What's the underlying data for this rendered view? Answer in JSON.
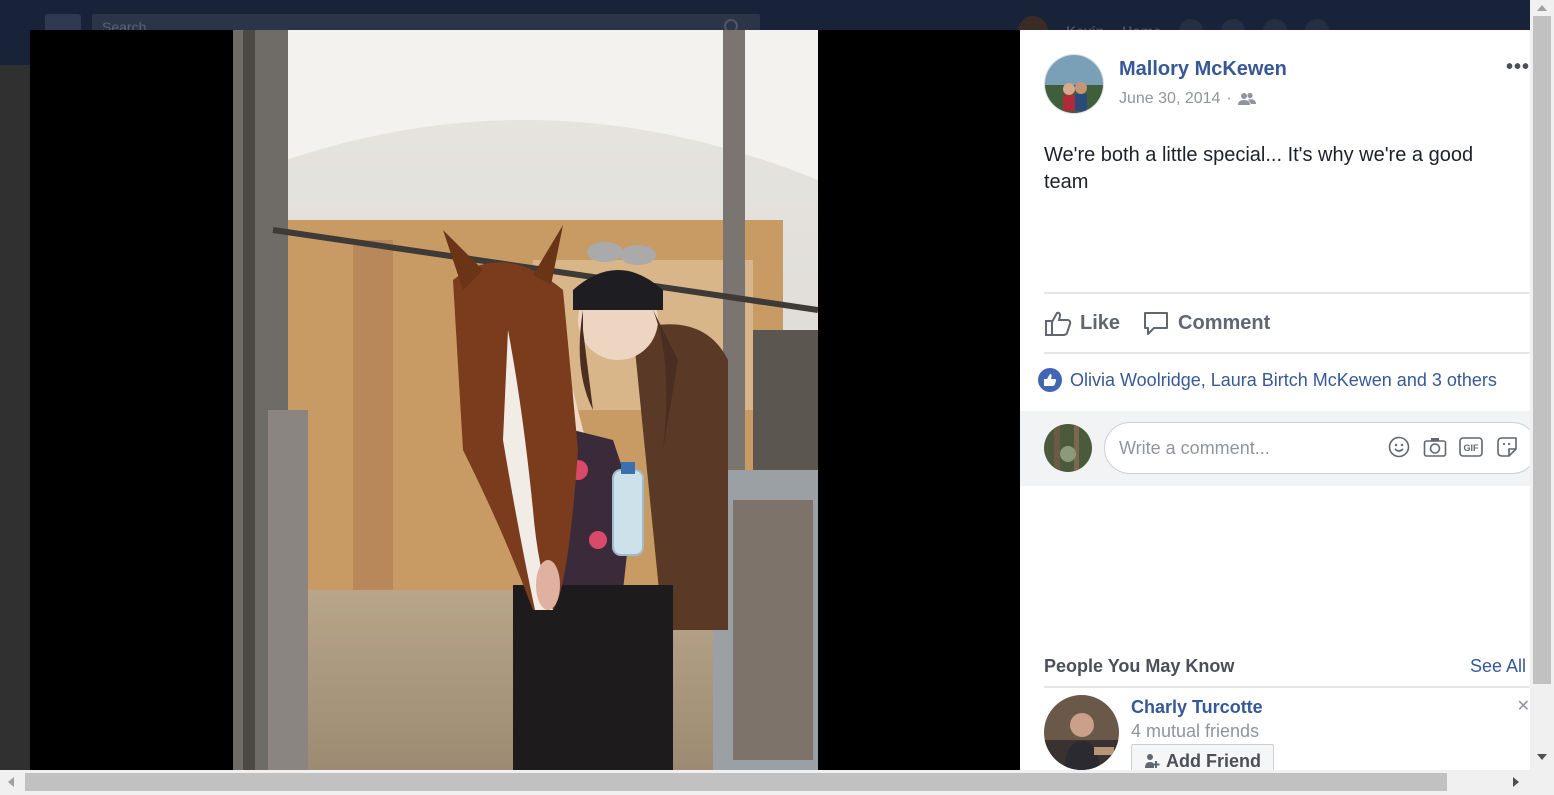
{
  "header": {
    "search_placeholder": "Search",
    "user_name": "Kevin",
    "home_label": "Home"
  },
  "post": {
    "author": "Mallory McKewen",
    "date": "June 30, 2014",
    "separator": "·",
    "privacy_icon": "friends-icon",
    "text": "We're both a little special... It's why we're a good team",
    "more_label": "•••",
    "like_label": "Like",
    "comment_label": "Comment",
    "likes_text": "Olivia Woolridge, Laura Birtch McKewen and 3 others"
  },
  "comment": {
    "placeholder": "Write a comment...",
    "icons": [
      "emoji-icon",
      "camera-icon",
      "gif-icon",
      "sticker-icon"
    ]
  },
  "pymk": {
    "title": "People You May Know",
    "see_all": "See All",
    "person": {
      "name": "Charly Turcotte",
      "mutual": "4 mutual friends",
      "add_label": "Add Friend"
    }
  },
  "colors": {
    "link": "#365899",
    "like_blue": "#4267b2",
    "theater_bg": "#000000"
  }
}
